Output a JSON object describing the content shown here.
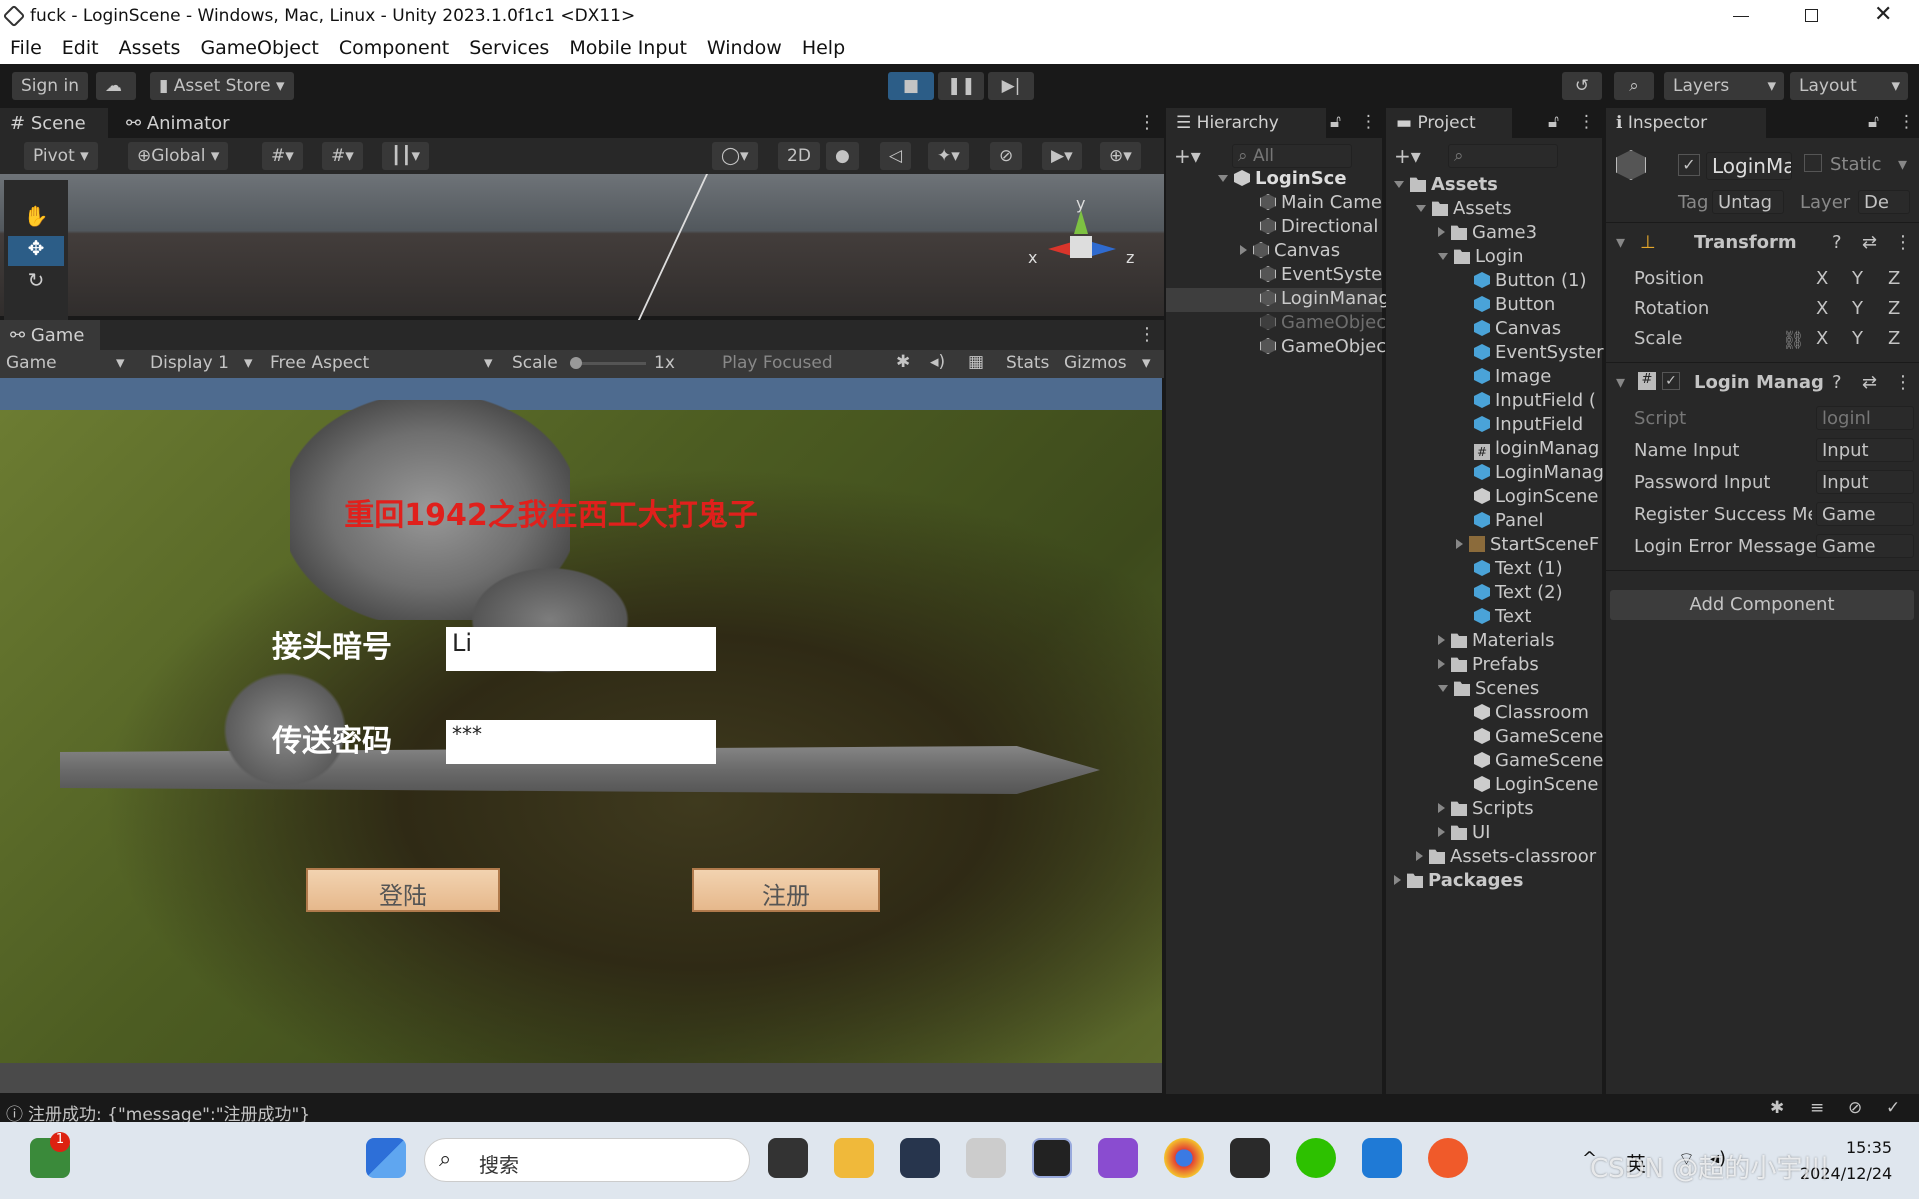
{
  "window": {
    "title": "fuck - LoginScene - Windows, Mac, Linux - Unity 2023.1.0f1c1 <DX11>"
  },
  "menu": [
    "File",
    "Edit",
    "Assets",
    "GameObject",
    "Component",
    "Services",
    "Mobile Input",
    "Window",
    "Help"
  ],
  "toolbar": {
    "signin": "Sign in",
    "asset_store": "Asset Store",
    "layers": "Layers",
    "layout": "Layout"
  },
  "scene": {
    "tab_scene": "Scene",
    "tab_animator": "Animator",
    "pivot": "Pivot",
    "global": "Global",
    "mode_2d": "2D",
    "gizmo_y": "y",
    "gizmo_x": "x",
    "gizmo_z": "z"
  },
  "game": {
    "tab": "Game",
    "game_dd": "Game",
    "display": "Display 1",
    "aspect": "Free Aspect",
    "scale_label": "Scale",
    "scale_value": "1x",
    "play_focused": "Play Focused",
    "stats": "Stats",
    "gizmos": "Gizmos",
    "title_text": "重回1942之我在西工大打鬼子",
    "label_name": "接头暗号",
    "label_password": "传送密码",
    "name_value": "Li",
    "password_value": "***",
    "login_btn": "登陆",
    "register_btn": "注册"
  },
  "hierarchy": {
    "tab": "Hierarchy",
    "search": "All",
    "root": "LoginSce",
    "items": [
      "Main Came",
      "Directional",
      "Canvas",
      "EventSyste",
      "LoginManag",
      "GameObjec",
      "GameObjec"
    ]
  },
  "project": {
    "tab": "Project",
    "items": [
      "Assets",
      "Assets",
      "Game3",
      "Login",
      "Button (1)",
      "Button",
      "Canvas",
      "EventSyster",
      "Image",
      "InputField (",
      "InputField",
      "loginManag",
      "LoginManag",
      "LoginScene",
      "Panel",
      "StartSceneF",
      "Text (1)",
      "Text (2)",
      "Text",
      "Materials",
      "Prefabs",
      "Scenes",
      "Classroom",
      "GameScene",
      "GameScene",
      "LoginScene",
      "Scripts",
      "UI",
      "Assets-classroor",
      "Packages"
    ]
  },
  "inspector": {
    "tab": "Inspector",
    "name": "LoginMa",
    "static": "Static",
    "tag_label": "Tag",
    "tag_value": "Untag",
    "layer_label": "Layer",
    "layer_value": "De",
    "transform": "Transform",
    "position": "Position",
    "rotation": "Rotation",
    "scale": "Scale",
    "x": "X",
    "y": "Y",
    "z": "Z",
    "component": "Login Manag",
    "script_label": "Script",
    "script_value": "loginl",
    "name_input": "Name Input",
    "name_input_v": "Input",
    "password_input": "Password Input",
    "password_input_v": "Input",
    "reg_msg": "Register Success Me",
    "reg_msg_v": "Game",
    "login_err": "Login Error Message",
    "login_err_v": "Game",
    "add_component": "Add Component"
  },
  "console": {
    "message": "注册成功: {\"message\":\"注册成功\"}"
  },
  "taskbar": {
    "search": "搜索",
    "ime": "英",
    "time": "15:35",
    "date": "2024/12/24",
    "badge": "1",
    "watermark": "CSDN @超的小宇川"
  }
}
